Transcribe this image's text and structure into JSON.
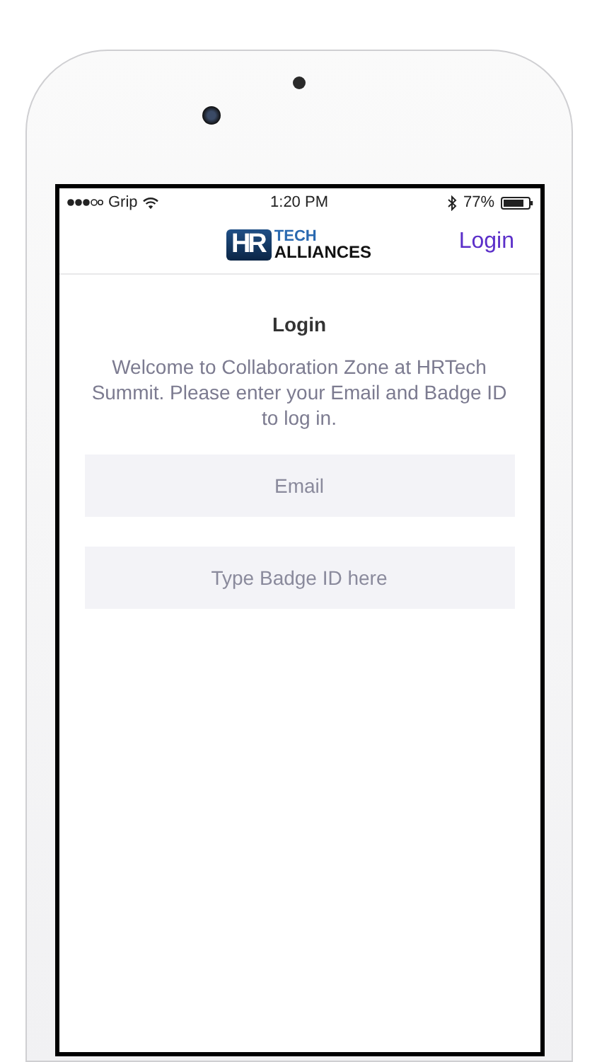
{
  "status_bar": {
    "carrier": "Grip",
    "time": "1:20 PM",
    "battery": "77%"
  },
  "header": {
    "logo": {
      "mark": "HR",
      "line1": "TECH",
      "line2": "ALLIANCES"
    },
    "action": "Login"
  },
  "title": "Login",
  "message": "Welcome to Collaboration Zone at HRTech Summit. Please enter your Email and Badge ID to log in.",
  "fields": [
    {
      "placeholder": "Email"
    },
    {
      "placeholder": "Type Badge ID here"
    }
  ]
}
